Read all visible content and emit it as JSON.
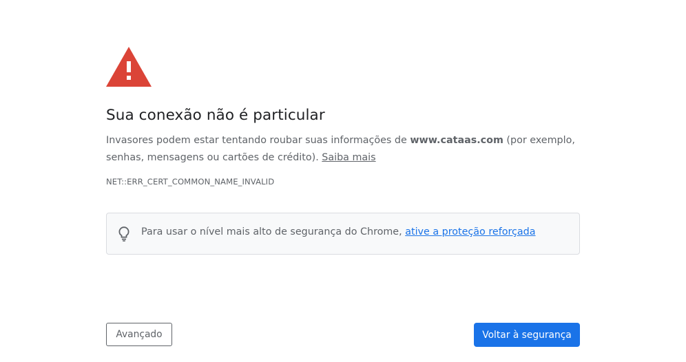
{
  "interstitial": {
    "heading": "Sua conexão não é particular",
    "explanation": {
      "prefix": "Invasores podem estar tentando roubar suas informações de ",
      "domain": "www.cataas.com",
      "suffix": " (por exemplo, senhas, mensagens ou cartões de crédito). ",
      "learn_more": "Saiba mais"
    },
    "error_code": "NET::ERR_CERT_COMMON_NAME_INVALID",
    "promo": {
      "text": "Para usar o nível mais alto de segurança do Chrome, ",
      "link": "ative a proteção reforçada",
      "icon": "lightbulb-icon"
    },
    "buttons": {
      "advanced": "Avançado",
      "back_to_safety": "Voltar à segurança"
    },
    "icon": "warning-triangle-icon"
  },
  "colors": {
    "warning_red": "#db4437",
    "primary_blue": "#1a73e8",
    "text_secondary": "#5f6368",
    "text_primary": "#202124",
    "promo_background": "#f8f9fa",
    "promo_border": "#dadce0"
  }
}
